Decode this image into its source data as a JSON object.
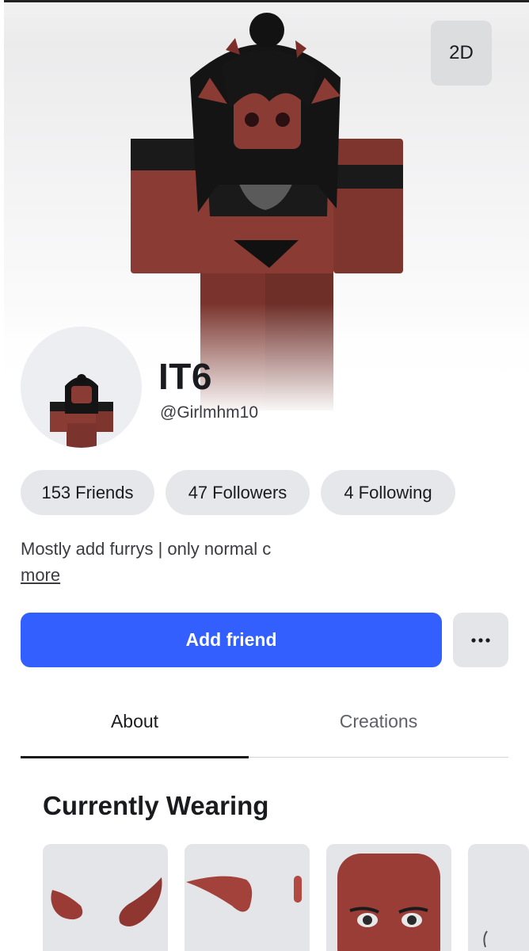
{
  "hero": {
    "toggle_2d_label": "2D"
  },
  "profile": {
    "display_name": "IT6",
    "username": "@Girlmhm10",
    "stats": [
      {
        "value": "153",
        "label": "Friends"
      },
      {
        "value": "47",
        "label": "Followers"
      },
      {
        "value": "4",
        "label": "Following"
      }
    ],
    "bio": "Mostly add furrys | only normal c",
    "bio_more_label": "more"
  },
  "actions": {
    "add_friend_label": "Add friend",
    "more_options_icon": "ellipsis-icon"
  },
  "tabs": [
    {
      "label": "About",
      "selected": true
    },
    {
      "label": "Creations",
      "selected": false
    }
  ],
  "wearing": {
    "title": "Currently Wearing",
    "items": [
      {
        "icon": "horns-icon"
      },
      {
        "icon": "elf-ears-icon"
      },
      {
        "icon": "face-head-icon"
      },
      {
        "icon": "accessory-icon"
      }
    ]
  },
  "colors": {
    "accent": "#335fff",
    "skin": "#8a3b33",
    "hair": "#141414"
  }
}
